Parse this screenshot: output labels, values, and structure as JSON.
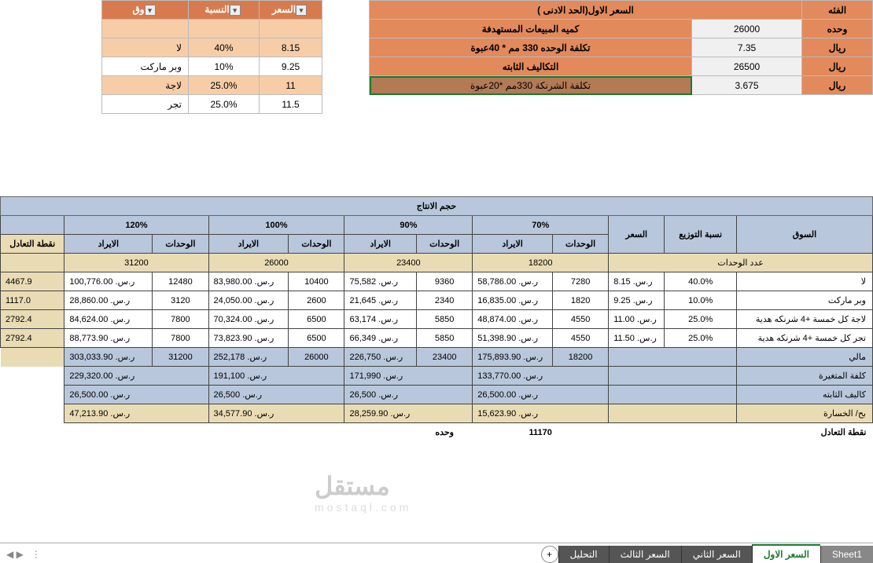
{
  "top": {
    "bigHeader": "السعر الاول(الحد الادنى )",
    "catHdr": "الفئه",
    "colPrice": "السعر",
    "colPct": "النسبة",
    "unitLbl": "وحده",
    "riyal": "ريال",
    "r1": {
      "label": "كميه المبيعات المستهدفة",
      "val": "26000"
    },
    "r2": {
      "label": "تكلفة الوحده 330 مم * 40عبوة",
      "val": "7.35",
      "price": "8.15",
      "pct": "40%",
      "mkt": "لا"
    },
    "r3": {
      "label": "التكاليف الثابته",
      "val": "26500",
      "price": "9.25",
      "pct": "10%",
      "mkt": "وبر ماركت"
    },
    "r4": {
      "label": "تكلفة الشرنكة 330مم *20عبوة",
      "val": "3.675",
      "price": "11",
      "pct": "25.0%",
      "mkt": "لاجة"
    },
    "r5": {
      "price": "11.5",
      "pct": "25.0%",
      "mkt": "تجر"
    }
  },
  "bot": {
    "prodVol": "حجم الانتاج",
    "pcts": {
      "p120": "120%",
      "p100": "100%",
      "p90": "90%",
      "p70": "70%"
    },
    "priceHdr": "السعر",
    "distHdr": "نسبة التوزيع",
    "mktHdr": "السوق",
    "rev": "الايراد",
    "units": "الوحدات",
    "bep": "نقطة التعادل",
    "unitCount": "عدد  الوحدات",
    "uc": {
      "u120": "31200",
      "u100": "26000",
      "u90": "23400",
      "u70": "18200"
    },
    "rows": [
      {
        "bep": "4467.9",
        "r120": "ر.س. 100,776.00",
        "u120": "12480",
        "r100": "ر.س. 83,980.00",
        "u100": "10400",
        "r90": "ر.س. 75,582",
        "u90": "9360",
        "r70": "ر.س. 58,786.00",
        "u70": "7280",
        "price": "ر.س. 8.15",
        "pct": "40.0%",
        "mkt": "لا"
      },
      {
        "bep": "1117.0",
        "r120": "ر.س. 28,860.00",
        "u120": "3120",
        "r100": "ر.س. 24,050.00",
        "u100": "2600",
        "r90": "ر.س. 21,645",
        "u90": "2340",
        "r70": "ر.س. 16,835.00",
        "u70": "1820",
        "price": "ر.س. 9.25",
        "pct": "10.0%",
        "mkt": "وبر ماركت"
      },
      {
        "bep": "2792.4",
        "r120": "ر.س. 84,624.00",
        "u120": "7800",
        "r100": "ر.س. 70,324.00",
        "u100": "6500",
        "r90": "ر.س. 63,174",
        "u90": "5850",
        "r70": "ر.س. 48,874.00",
        "u70": "4550",
        "price": "ر.س. 11.00",
        "pct": "25.0%",
        "mkt": "لاجة كل خمسة +4 شرنكه هدية"
      },
      {
        "bep": "2792.4",
        "r120": "ر.س. 88,773.90",
        "u120": "7800",
        "r100": "ر.س. 73,823.90",
        "u100": "6500",
        "r90": "ر.س. 66,349",
        "u90": "5850",
        "r70": "ر.س. 51,398.90",
        "u70": "4550",
        "price": "ر.س. 11.50",
        "pct": "25.0%",
        "mkt": "تجر كل خمسة +4 شرنكه هدية"
      }
    ],
    "totRow": {
      "r120": "ر.س. 303,033.90",
      "u120": "31200",
      "r100": "ر.س. 252,178",
      "u100": "26000",
      "r90": "ر.س. 226,750",
      "u90": "23400",
      "r70": "ر.س. 175,893.90",
      "u70": "18200",
      "mkt": "مالي"
    },
    "varRow": {
      "r120": "ر.س. 229,320.00",
      "r100": "ر.س. 191,100",
      "r90": "ر.س. 171,990",
      "r70": "ر.س. 133,770.00",
      "mkt": "كلفة المتغيرة"
    },
    "fixRow": {
      "r120": "ر.س. 26,500.00",
      "r100": "ر.س. 26,500",
      "r90": "ر.س. 26,500",
      "r70": "ر.س. 26,500.00",
      "mkt": "كاليف الثابته"
    },
    "plRow": {
      "r120": "ر.س. 47,213.90",
      "r100": "ر.س. 34,577.90",
      "r90": "ر.س. 28,259.90",
      "r70": "ر.س. 15,623.90",
      "mkt": "بح/ الخسارة"
    },
    "bepLabel": "نقطة التعادل",
    "bepVal": "11170",
    "bepUnit": "وحده"
  },
  "tabs": {
    "sheet1": "Sheet1",
    "p1": "السعر الاول",
    "p2": "السعر الثاني",
    "p3": "السعر الثالث",
    "ana": "التحليل"
  },
  "wm": "مستقل",
  "wm2": "mostaql.com"
}
